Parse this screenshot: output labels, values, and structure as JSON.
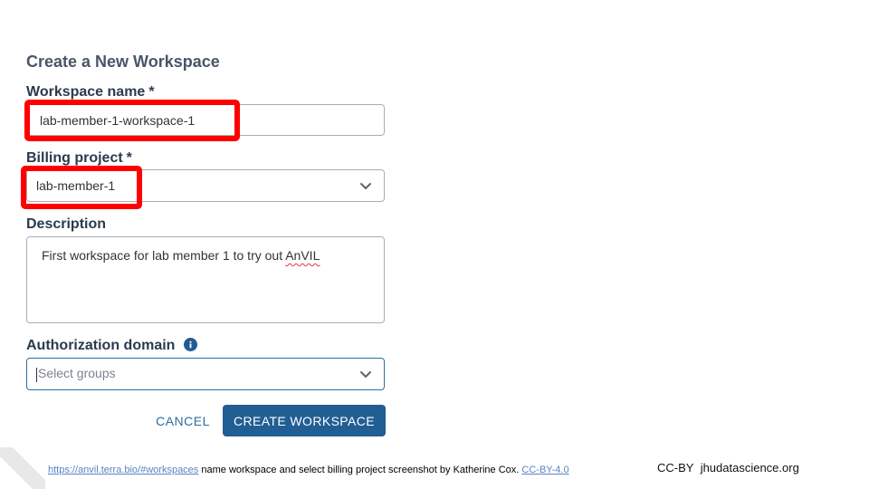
{
  "form": {
    "title": "Create a New Workspace",
    "workspace_name": {
      "label": "Workspace name",
      "required_mark": "*",
      "value": "lab-member-1-workspace-1"
    },
    "billing_project": {
      "label": "Billing project",
      "required_mark": "*",
      "value": "lab-member-1"
    },
    "description": {
      "label": "Description",
      "value_prefix": "First workspace for lab member 1 to try out ",
      "value_flagged": "AnVIL"
    },
    "authorization_domain": {
      "label": "Authorization domain",
      "placeholder": "Select groups"
    },
    "buttons": {
      "cancel": "CANCEL",
      "create": "CREATE WORKSPACE"
    }
  },
  "caption": {
    "link": "https://anvil.terra.bio/#workspaces",
    "text": " name workspace and select billing project screenshot by Katherine Cox.  ",
    "license_link": "CC-BY-4.0"
  },
  "footer": {
    "license": "CC-BY",
    "site": "jhudatascience.org"
  },
  "colors": {
    "highlight": "#ff0000",
    "primary_button": "#215e93",
    "link": "#2e6d9f"
  }
}
